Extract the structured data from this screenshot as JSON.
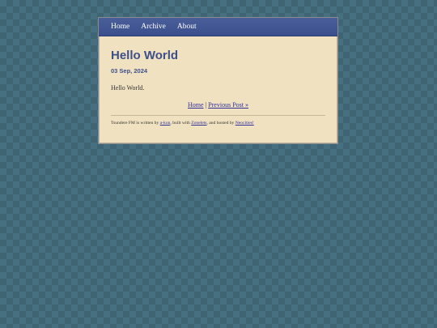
{
  "nav": {
    "items": [
      {
        "label": "Home"
      },
      {
        "label": "Archive"
      },
      {
        "label": "About"
      }
    ]
  },
  "post": {
    "title": "Hello World",
    "date": "03 Sep, 2024",
    "body": "Hello World."
  },
  "post_nav": {
    "home_label": "Home",
    "separator": "|",
    "prev_label": "Previous Post »"
  },
  "footer": {
    "text1": "Tsundere FM is written by ",
    "author_link": "a-kun",
    "text2": ", built with ",
    "builder_link": "Zonelets",
    "text3": ", and hosted by ",
    "host_link": "Neocities!"
  }
}
